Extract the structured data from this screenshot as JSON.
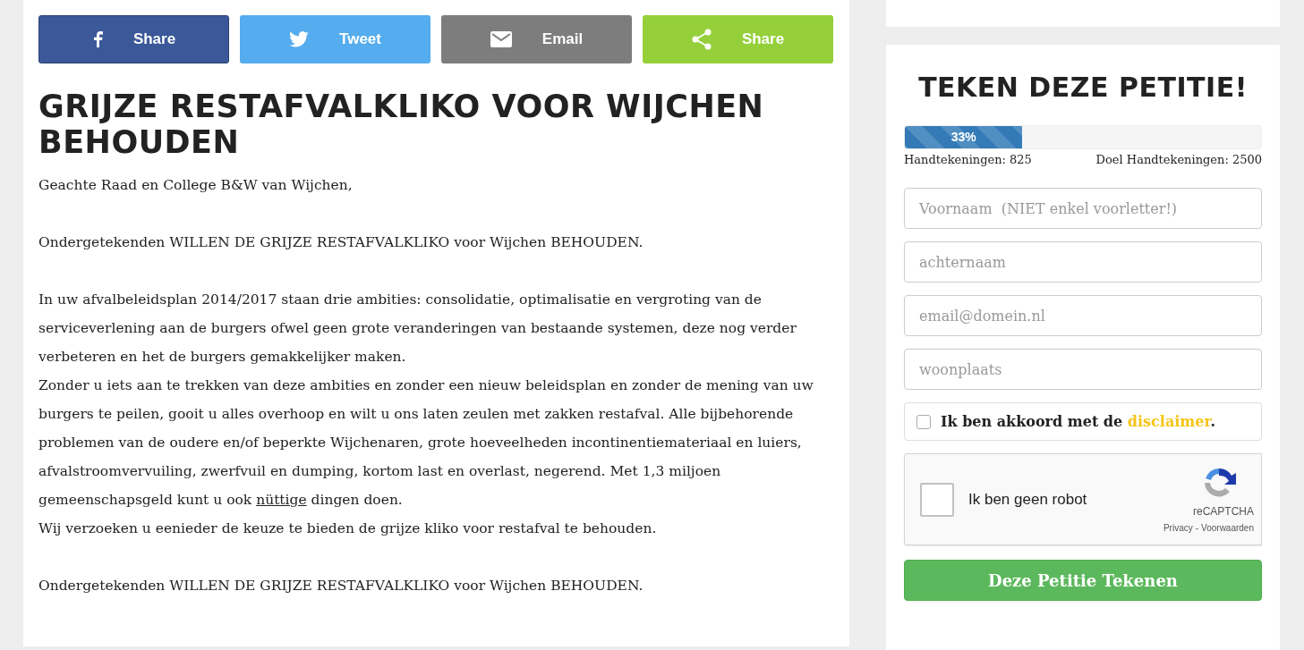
{
  "share_buttons": [
    {
      "kind": "facebook",
      "label": "Share"
    },
    {
      "kind": "twitter",
      "label": "Tweet"
    },
    {
      "kind": "email",
      "label": "Email"
    },
    {
      "kind": "share",
      "label": "Share"
    }
  ],
  "article": {
    "title": "GRIJZE RESTAFVALKLIKO VOOR WIJCHEN BEHOUDEN",
    "paragraphs": [
      {
        "text": "Geachte Raad en College B&W van Wijchen,"
      },
      {
        "text": "Ondergetekenden WILLEN DE GRIJZE RESTAFVALKLIKO voor Wijchen BEHOUDEN."
      },
      {
        "text": "In uw afvalbeleidsplan 2014/2017 staan drie ambities: consolidatie, optimalisatie en vergroting van de serviceverlening aan de burgers ofwel geen grote veranderingen van bestaande systemen, deze nog verder verbeteren en het de burgers gemakkelijker maken.\nZonder u iets aan te trekken van  deze ambities en zonder een nieuw beleidsplan en zonder de mening van uw burgers te peilen, gooit u alles overhoop en wilt u ons laten zeulen met zakken restafval. Alle bijbehorende problemen van de oudere en/of beperkte Wijchenaren, grote hoeveelheden incontinentiemateriaal en luiers, afvalstroomvervuiling, zwerfvuil en dumping, kortom last en overlast, negerend. Met 1,3 miljoen gemeenschapsgeld kunt u ook ",
        "link": "nüttige",
        "after": " dingen doen.\nWij verzoeken u eenieder de keuze te bieden de grijze kliko voor restafval te behouden."
      },
      {
        "text": "Ondergetekenden WILLEN DE GRIJZE RESTAFVALKLIKO voor Wijchen BEHOUDEN."
      }
    ]
  },
  "petition": {
    "title": "TEKEN DEZE PETITIE!",
    "progress": {
      "level": 0.33,
      "label": "33%"
    },
    "signatures": "Handtekeningen: 825",
    "goal": "Doel Handtekeningen: 2500",
    "fields": [
      {
        "placeholder": "Voornaam  (NIET enkel voorletter!)"
      },
      {
        "placeholder": "achternaam"
      },
      {
        "placeholder": "email@domein.nl"
      },
      {
        "placeholder": "woonplaats"
      }
    ],
    "agree": {
      "checked": false,
      "text": "Ik ben akkoord met de ",
      "link": "disclaimer",
      "after": "."
    },
    "captcha": {
      "checked": false,
      "label": "Ik ben geen robot",
      "brand": "reCAPTCHA",
      "privacy": "Privacy",
      "separator": "-",
      "terms": "Voorwaarden"
    },
    "submit": "Deze Petitie Tekenen"
  }
}
